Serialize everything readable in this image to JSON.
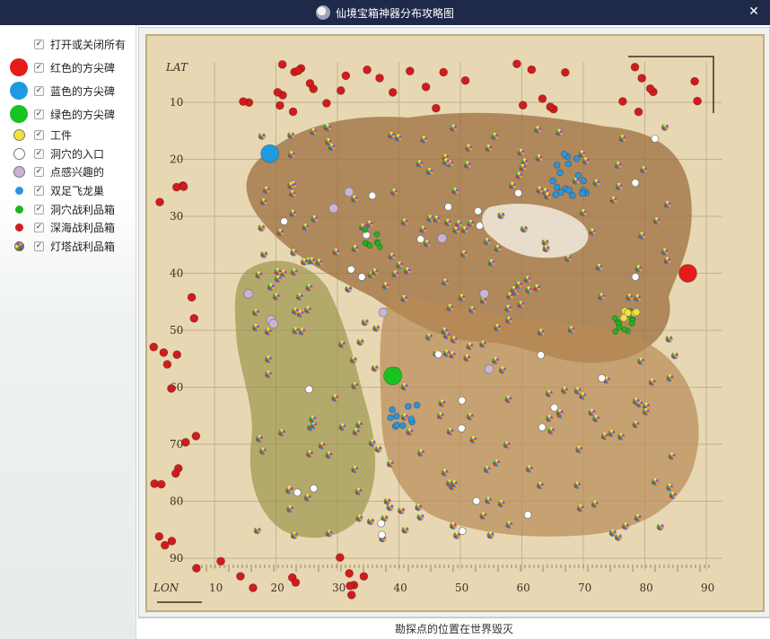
{
  "window": {
    "title": "仙境宝箱神器分布攻略图",
    "icon": "app-icon",
    "close_label": "✕"
  },
  "legend": {
    "items": [
      {
        "key": "toggle-all",
        "label": "打开或关闭所有",
        "marker": "none",
        "checked": true
      },
      {
        "key": "red-obelisk",
        "label": "红色的方尖碑",
        "marker": "big",
        "color": "#e31b1b",
        "checked": true
      },
      {
        "key": "blue-obelisk",
        "label": "蓝色的方尖碑",
        "marker": "big",
        "color": "#1e9be0",
        "checked": true
      },
      {
        "key": "green-obelisk",
        "label": "绿色的方尖碑",
        "marker": "big",
        "color": "#19c21e",
        "checked": true
      },
      {
        "key": "artifact",
        "label": "工件",
        "marker": "med",
        "color": "#f2e23a",
        "checked": true
      },
      {
        "key": "cave-entrance",
        "label": "洞穴的入口",
        "marker": "med",
        "color": "#ffffff",
        "checked": true
      },
      {
        "key": "point-of-interest",
        "label": "点感兴趣的",
        "marker": "med",
        "color": "#c8b4d6",
        "checked": true
      },
      {
        "key": "wyvern-nest",
        "label": "双足飞龙巢",
        "marker": "small",
        "color": "#2f93d6",
        "checked": true
      },
      {
        "key": "cave-loot-crate",
        "label": "洞穴战利品箱",
        "marker": "small",
        "color": "#1fb51f",
        "checked": true
      },
      {
        "key": "deep-sea-crate",
        "label": "深海战利品箱",
        "marker": "small",
        "color": "#d01c1c",
        "checked": true
      },
      {
        "key": "beacon-crate",
        "label": "灯塔战利品箱",
        "marker": "crate",
        "color": "multicolor",
        "checked": true
      }
    ]
  },
  "map": {
    "lat_label": "LAT",
    "lon_label": "LON",
    "lat_ticks": [
      "10",
      "20",
      "30",
      "40",
      "50",
      "60",
      "70",
      "80",
      "90"
    ],
    "lon_ticks": [
      "10",
      "20",
      "30",
      "40",
      "50",
      "60",
      "70",
      "80",
      "90"
    ],
    "parchment_color": "#e7d8b3",
    "land_color": "#9c6f3d",
    "grass_color": "#8f8b3a",
    "markers": {
      "red_obelisk": {
        "lat": 40,
        "lon": 87
      },
      "blue_obelisk": {
        "lat": 19,
        "lon": 19
      },
      "green_obelisk": {
        "lat": 58,
        "lon": 39
      }
    }
  },
  "status": {
    "text": "勘探点的位置在世界毁灭"
  }
}
